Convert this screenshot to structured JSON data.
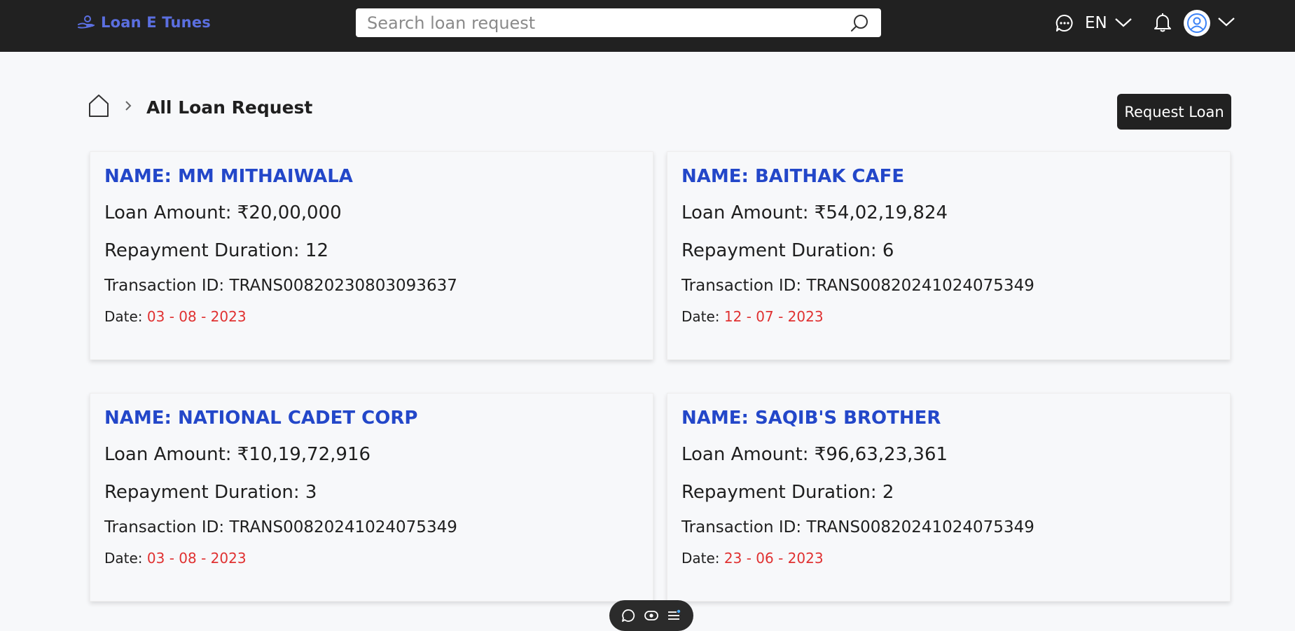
{
  "app": {
    "logo_text": "Loan E Tunes"
  },
  "search": {
    "placeholder": "Search loan request",
    "value": ""
  },
  "header": {
    "language": "EN"
  },
  "breadcrumb": {
    "title": "All Loan Request"
  },
  "actions": {
    "request_loan_label": "Request Loan"
  },
  "loans": [
    {
      "name": "NAME: MM MITHAIWALA",
      "amount": "Loan Amount: ₹20,00,000",
      "duration": "Repayment Duration: 12",
      "transaction": "Transaction ID: TRANS00820230803093637",
      "date_label": "Date: ",
      "date": "03 - 08 - 2023"
    },
    {
      "name": "NAME: BAITHAK CAFE",
      "amount": "Loan Amount: ₹54,02,19,824",
      "duration": "Repayment Duration: 6",
      "transaction": "Transaction ID: TRANS00820241024075349",
      "date_label": "Date: ",
      "date": "12 - 07 - 2023"
    },
    {
      "name": "NAME: NATIONAL CADET CORP",
      "amount": "Loan Amount: ₹10,19,72,916",
      "duration": "Repayment Duration: 3",
      "transaction": "Transaction ID: TRANS00820241024075349",
      "date_label": "Date: ",
      "date": "03 - 08 - 2023"
    },
    {
      "name": "NAME: SAQIB'S BROTHER",
      "amount": "Loan Amount: ₹96,63,23,361",
      "duration": "Repayment Duration: 2",
      "transaction": "Transaction ID: TRANS00820241024075349",
      "date_label": "Date: ",
      "date": "23 - 06 - 2023"
    }
  ],
  "colors": {
    "header_bg": "#212121",
    "accent": "#5b6fe0",
    "name_blue": "#2347c9",
    "date_red": "#e03131"
  }
}
